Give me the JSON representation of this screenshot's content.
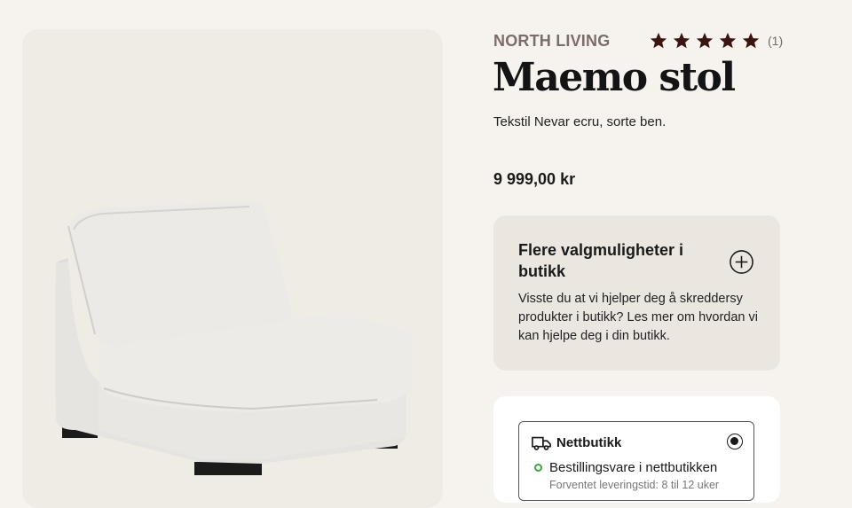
{
  "product": {
    "brand": "NORTH LIVING",
    "rating": {
      "stars": 5,
      "max": 5,
      "count_label": "(1)",
      "star_color": "#3b1512"
    },
    "title": "Maemo stol",
    "subtitle": "Tekstil Nevar ecru, sorte ben.",
    "price": "9 999,00 kr"
  },
  "options_card": {
    "heading": "Flere valgmuligheter i butikk",
    "body": "Visste du at vi hjelper deg å skreddersy produkter i butikk? Les mer om hvordan vi kan hjelpe deg i din butikk.",
    "icon": "plus-circle-icon"
  },
  "delivery": {
    "option_label": "Nettbutikk",
    "option_icon": "truck-icon",
    "selected": true,
    "status": "Bestillingsvare i nettbutikken",
    "status_color": "#3aa33c",
    "estimate": "Forventet leveringstid: 8 til 12 uker"
  },
  "image": {
    "depicts": "chair-image"
  }
}
